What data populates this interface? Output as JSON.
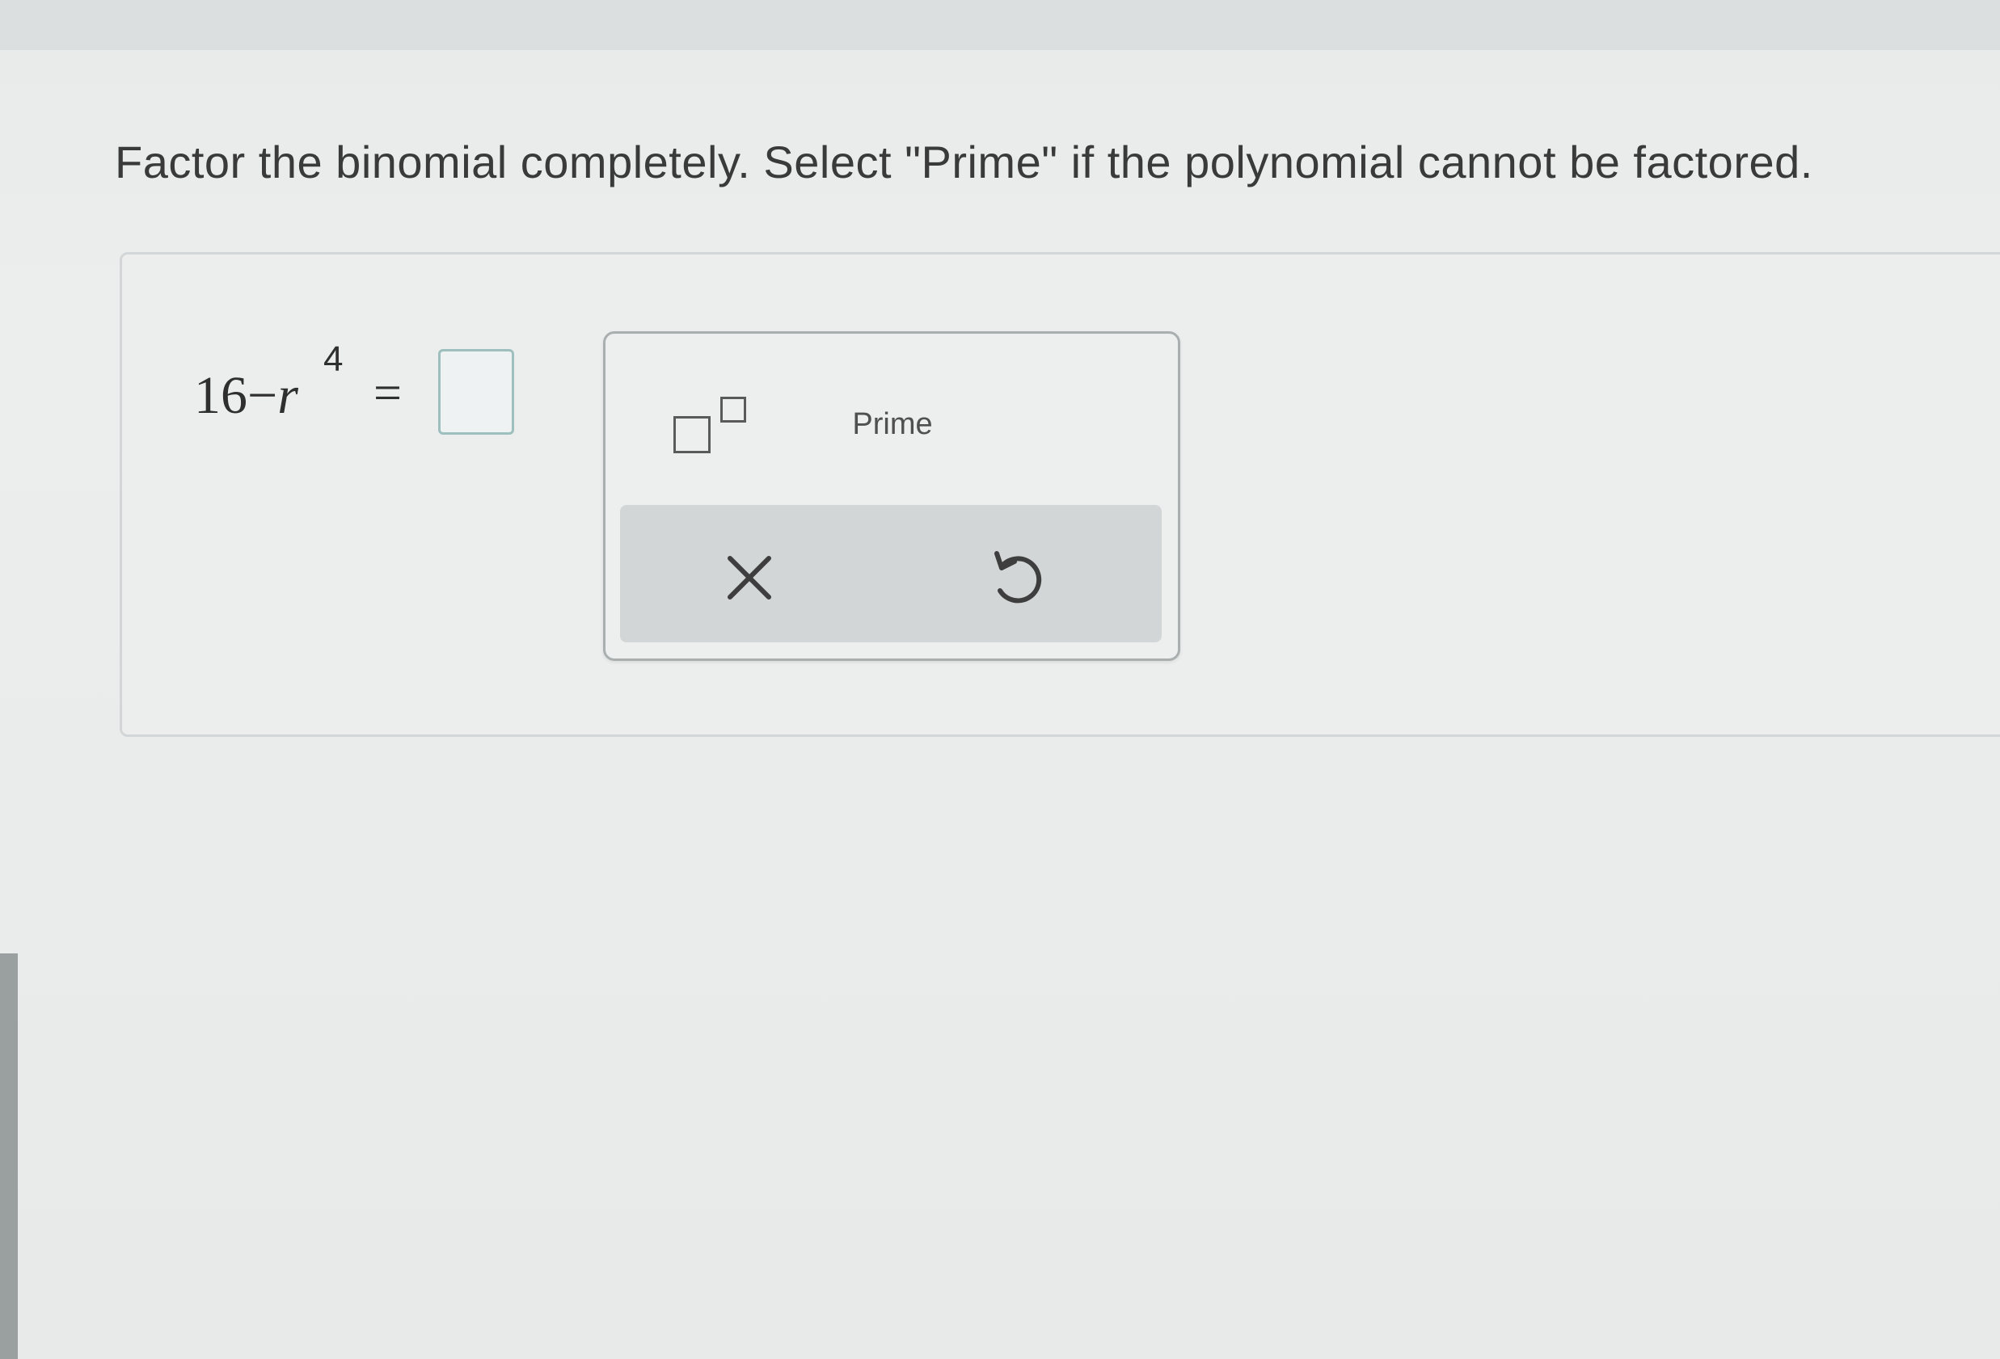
{
  "question": {
    "text": "Factor the binomial completely. Select \"Prime\" if the polynomial cannot be factored."
  },
  "equation": {
    "constant": "16",
    "operator": "−",
    "variable": "r",
    "exponent": "4",
    "equals": "="
  },
  "answer": {
    "value": ""
  },
  "keypad": {
    "exponent_button": "exponent-template",
    "prime_label": "Prime",
    "clear_icon": "x-icon",
    "undo_icon": "undo-icon"
  },
  "colors": {
    "answer_border": "#9dbfbd",
    "keypad_border": "#a9aeae",
    "action_bar": "#d3d6d6"
  }
}
